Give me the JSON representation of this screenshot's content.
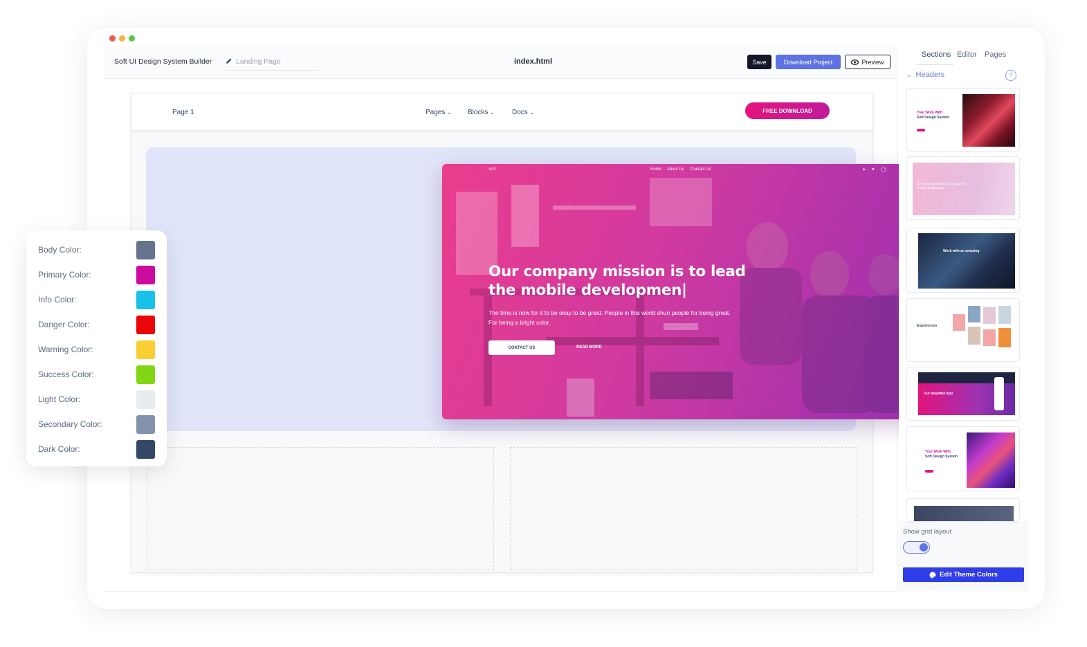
{
  "window": {
    "traffic_lights": [
      "#ee5a52",
      "#f6b53f",
      "#5fc444"
    ]
  },
  "topbar": {
    "app_title": "Soft UI Design System Builder",
    "page_name": "Landing Page",
    "file_name": "index.html",
    "save_label": "Save",
    "download_label": "Download Project",
    "preview_label": "Preview"
  },
  "canvas_nav": {
    "page_label": "Page 1",
    "links": [
      "Pages",
      "Blocks",
      "Docs"
    ],
    "cta_label": "FREE DOWNLOAD"
  },
  "hero": {
    "brand": "Soft",
    "nav_links": [
      "Home",
      "About Us",
      "Contact Us"
    ],
    "title": "Our company mission is to lead the mobile developmen|",
    "subtitle": "The time is now for it to be okay to be great. People in this world shun people for being great. For being a bright color.",
    "contact_label": "CONTACT US",
    "read_more_label": "READ MORE"
  },
  "palette": {
    "items": [
      {
        "label": "Body Color:",
        "color": "#67748e"
      },
      {
        "label": "Primary Color:",
        "color": "#cb0c9f"
      },
      {
        "label": "Info Color:",
        "color": "#17c1e8"
      },
      {
        "label": "Danger Color:",
        "color": "#ea0606"
      },
      {
        "label": "Warning Color:",
        "color": "#fbcf33"
      },
      {
        "label": "Success Color:",
        "color": "#82d616"
      },
      {
        "label": "Light Color:",
        "color": "#e9ecef"
      },
      {
        "label": "Secondary Color:",
        "color": "#8392ab"
      },
      {
        "label": "Dark Color:",
        "color": "#344767"
      }
    ]
  },
  "right_panel": {
    "tabs": [
      "Sections",
      "Editor",
      "Pages"
    ],
    "section_title": "Headers",
    "info_badge": "?",
    "thumbs": [
      {
        "line1": "Your Work With",
        "line2": "Soft Design System"
      },
      {
        "line1": "Our company mission is to lead the",
        "line2": "mobile development"
      },
      {
        "line1": "Work with an amazing",
        "line2": ""
      },
      {
        "line1": "Experiences",
        "line2": ""
      },
      {
        "line1": "Our beautiful App",
        "line2": ""
      },
      {
        "line1": "Your Work With",
        "line2": "Soft Design System"
      }
    ],
    "grid_label": "Show grid layout",
    "edit_colors_label": "Edit Theme Colors"
  }
}
